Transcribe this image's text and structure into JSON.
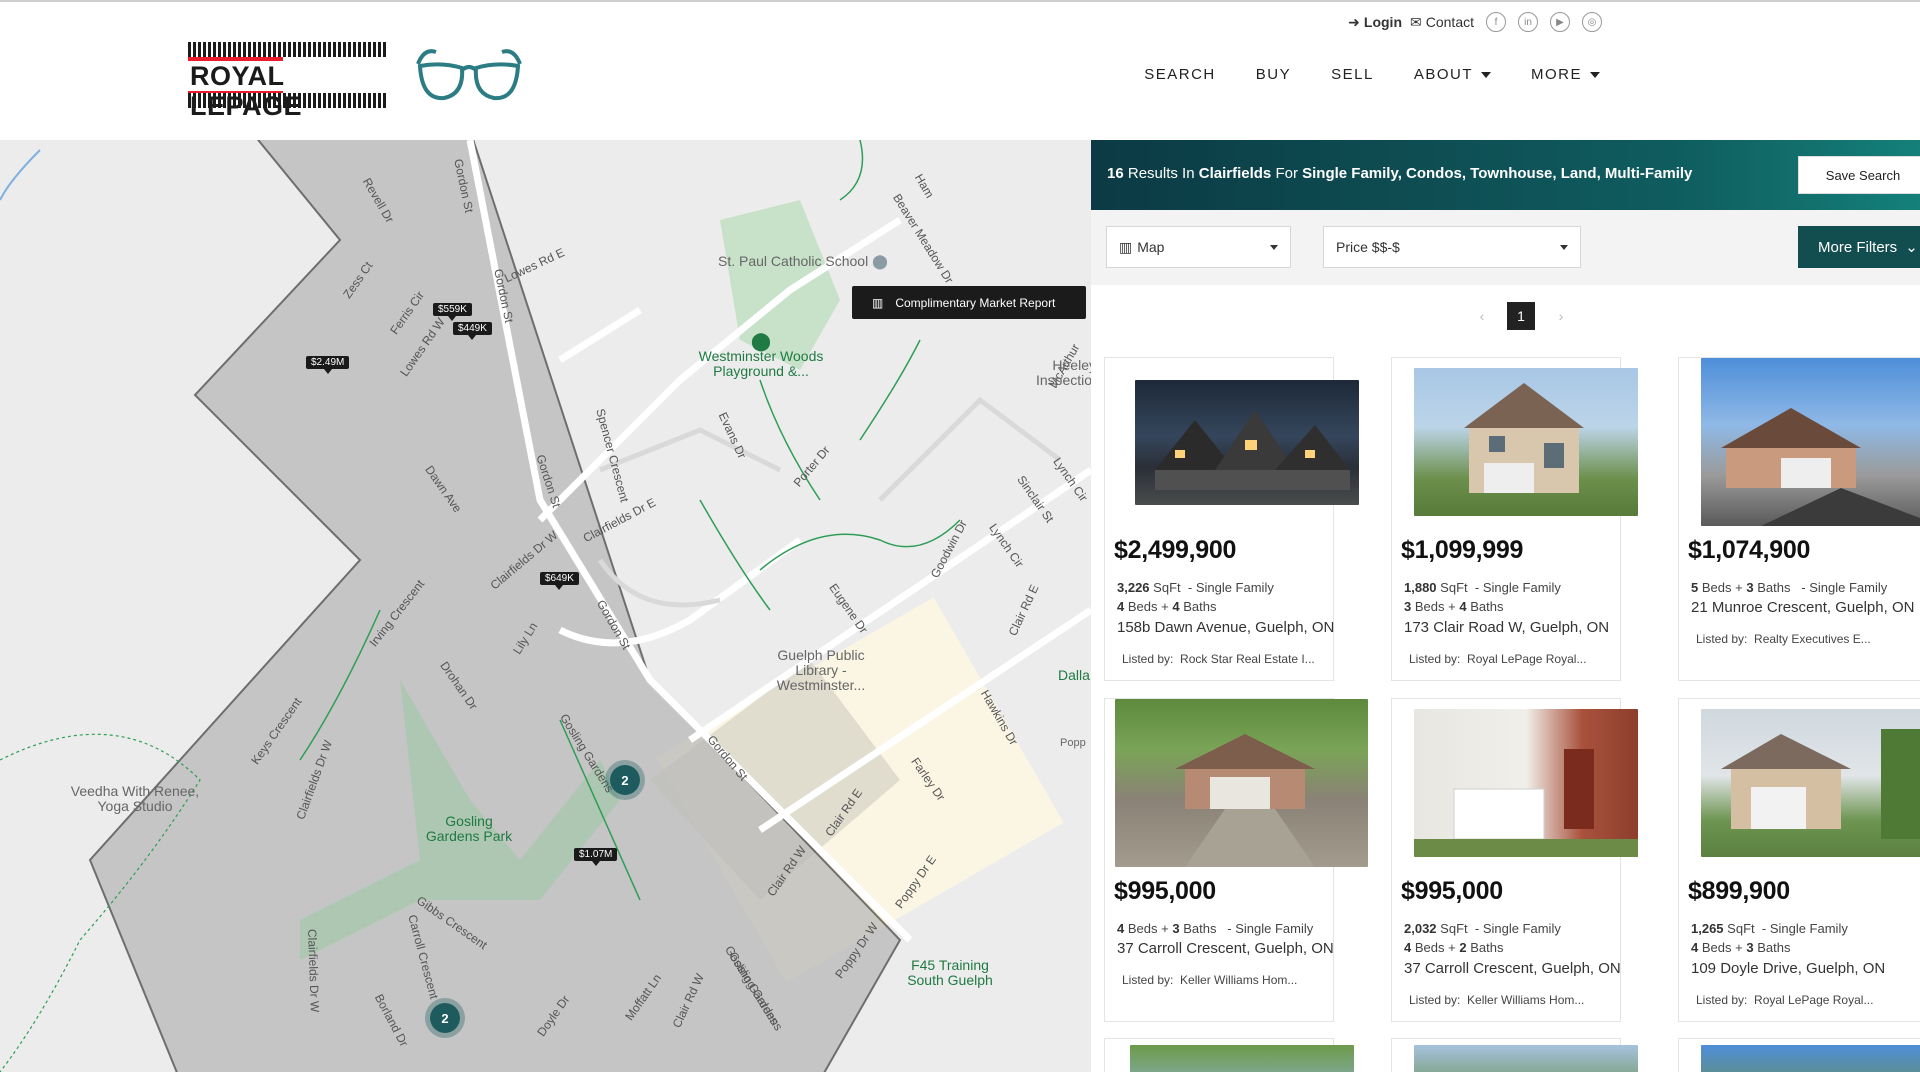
{
  "header": {
    "brand": "ROYAL LEPAGE",
    "utility": {
      "login": "Login",
      "contact": "Contact"
    },
    "social_icons": [
      "facebook-icon",
      "linkedin-icon",
      "youtube-icon",
      "instagram-icon"
    ],
    "nav": [
      {
        "label": "SEARCH",
        "dropdown": false
      },
      {
        "label": "BUY",
        "dropdown": false
      },
      {
        "label": "SELL",
        "dropdown": false
      },
      {
        "label": "ABOUT",
        "dropdown": true
      },
      {
        "label": "MORE",
        "dropdown": true
      }
    ]
  },
  "map": {
    "market_report_button": "Complimentary Market Report",
    "streets": [
      "Revell Dr",
      "Gordon St",
      "Lowes Rd E",
      "Zess Ct",
      "Ferris Cir",
      "Lowes Rd W",
      "Dawn Ave",
      "Spencer Crescent",
      "Clairfields Dr E",
      "Clairfields Dr W",
      "Lily Ln",
      "Irving Crescent",
      "Drohan Dr",
      "Gosling Gardens",
      "Keys Crescent",
      "Clairfields Dr W",
      "Gibbs Crescent",
      "Carroll Crescent",
      "Borland Dr",
      "Clairfields Dr W",
      "Doyle Dr",
      "Moffatt Ln",
      "Clair Rd W",
      "Gosling Gardens",
      "Evans Dr",
      "Porter Dr",
      "Eugene Dr",
      "Goodwin Dr",
      "Lynch Cir",
      "Sinclair St",
      "Beaver Meadow Dr",
      "McArthur",
      "Lynch Cir",
      "Clair Rd E",
      "Hawkins Dr",
      "Farley Dr",
      "Poppy Dr E",
      "Poppy Dr W",
      "Clair Rd E",
      "Gordon St",
      "Gordon St",
      "Gosling Gardens",
      "Gordon St",
      "Gordon St",
      "Clair Rd W",
      "Ham"
    ],
    "pois": [
      {
        "name": "St. Paul Catholic School"
      },
      {
        "name": "Westminster Woods Playground &..."
      },
      {
        "name": "Guelph Public Library - Westminster..."
      },
      {
        "name": "Veedha With Renee, Yoga Studio"
      },
      {
        "name": "Gosling Gardens Park"
      },
      {
        "name": "F45 Training South Guelph"
      },
      {
        "name": "Heeley Inspection"
      },
      {
        "name": "Dalla"
      },
      {
        "name": "Popp"
      }
    ],
    "price_pins": [
      "$559K",
      "$449K",
      "$2.49M",
      "$649K",
      "$1.07M"
    ],
    "clusters": [
      "2",
      "2"
    ]
  },
  "results": {
    "count": "16",
    "results_in": "Results In",
    "area": "Clairfields",
    "for_word": "For",
    "types": "Single Family, Condos, Townhouse, Land, Multi-Family",
    "save_search": "Save Search",
    "view_select": "Map",
    "price_select": "Price $$-$",
    "more_filters": "More Filters",
    "pages": {
      "prev": "‹",
      "current": "1",
      "next": "›"
    },
    "listed_by_label": "Listed by:",
    "beds_label": "Beds",
    "baths_label": "Baths",
    "sqft_label": "SqFt",
    "plus": "+",
    "listings": [
      {
        "price": "$2,499,900",
        "sqft": "3,226",
        "type": "Single Family",
        "beds": "4",
        "baths": "4",
        "address": "158b Dawn Avenue, Guelph, ON",
        "listed_by": "Rock Star Real Estate I..."
      },
      {
        "price": "$1,099,999",
        "sqft": "1,880",
        "type": "Single Family",
        "beds": "3",
        "baths": "4",
        "address": "173 Clair Road W, Guelph, ON",
        "listed_by": "Royal LePage Royal..."
      },
      {
        "price": "$1,074,900",
        "sqft": "",
        "type": "Single Family",
        "beds": "5",
        "baths": "3",
        "address": "21 Munroe Crescent, Guelph, ON",
        "listed_by": "Realty Executives E..."
      },
      {
        "price": "$995,000",
        "sqft": "",
        "type": "Single Family",
        "beds": "4",
        "baths": "3",
        "address": "37 Carroll Crescent, Guelph, ON",
        "listed_by": "Keller Williams Hom..."
      },
      {
        "price": "$995,000",
        "sqft": "2,032",
        "type": "Single Family",
        "beds": "4",
        "baths": "2",
        "address": "37 Carroll Crescent, Guelph, ON",
        "listed_by": "Keller Williams Hom..."
      },
      {
        "price": "$899,900",
        "sqft": "1,265",
        "type": "Single Family",
        "beds": "4",
        "baths": "3",
        "address": "109 Doyle Drive, Guelph, ON",
        "listed_by": "Royal LePage Royal..."
      }
    ]
  },
  "colors": {
    "brand_red": "#ea1c2d",
    "teal_dark": "#0c3a44",
    "teal": "#124d50",
    "cluster": "#1e5b5e",
    "glasses": "#2c7d83"
  }
}
